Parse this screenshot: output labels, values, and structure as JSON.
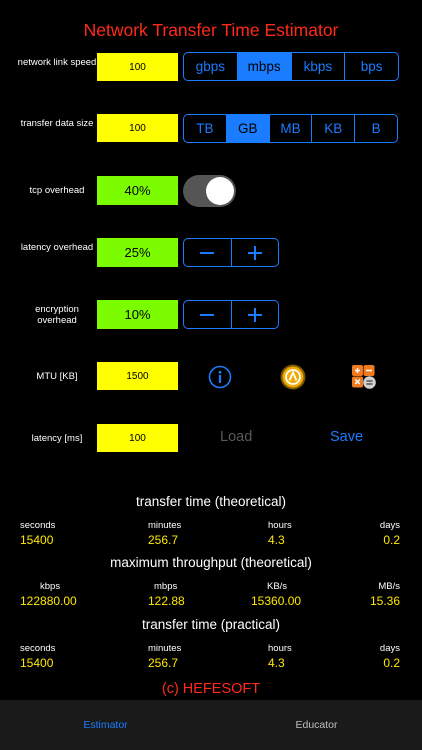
{
  "app": {
    "title": "Network Transfer Time Estimator",
    "brand": "(c) HEFESOFT"
  },
  "rows": {
    "link_speed": {
      "label": "network link speed",
      "value": "100",
      "units": [
        "gbps",
        "mbps",
        "kbps",
        "bps"
      ],
      "selected": "mbps"
    },
    "data_size": {
      "label": "transfer data size",
      "value": "100",
      "units": [
        "TB",
        "GB",
        "MB",
        "KB",
        "B"
      ],
      "selected": "GB"
    },
    "tcp_overhead": {
      "label": "tcp overhead",
      "value": "40%",
      "enabled": true
    },
    "latency_overhead": {
      "label": "latency overhead",
      "value": "25%"
    },
    "encryption_overhead": {
      "label": "encryption overhead",
      "value": "10%"
    },
    "mtu": {
      "label": "MTU [KB]",
      "value": "1500"
    },
    "latency": {
      "label": "latency [ms]",
      "value": "100"
    }
  },
  "actions": {
    "load": "Load",
    "save": "Save"
  },
  "stepper": {
    "minus": "−",
    "plus": "+"
  },
  "results": {
    "theoretical": {
      "title": "transfer time (theoretical)",
      "labels": [
        "seconds",
        "minutes",
        "hours",
        "days"
      ],
      "values": [
        "15400",
        "256.7",
        "4.3",
        "0.2"
      ]
    },
    "throughput": {
      "title": "maximum throughput (theoretical)",
      "labels": [
        "kbps",
        "mbps",
        "KB/s",
        "MB/s"
      ],
      "values": [
        "122880.00",
        "122.88",
        "15360.00",
        "15.36"
      ]
    },
    "practical": {
      "title": "transfer time (practical)",
      "labels": [
        "seconds",
        "minutes",
        "hours",
        "days"
      ],
      "values": [
        "15400",
        "256.7",
        "4.3",
        "0.2"
      ]
    }
  },
  "tabs": [
    {
      "label": "Estimator",
      "active": true
    },
    {
      "label": "Educator",
      "active": false
    }
  ],
  "colors": {
    "accent": "#1a7cff",
    "title": "#ff2a1a",
    "input_yellow": "#ffff00",
    "input_green": "#7cfc00",
    "value": "#ffe800",
    "disabled": "#5a5a5a",
    "inactive_tab": "#bfbfbf"
  }
}
